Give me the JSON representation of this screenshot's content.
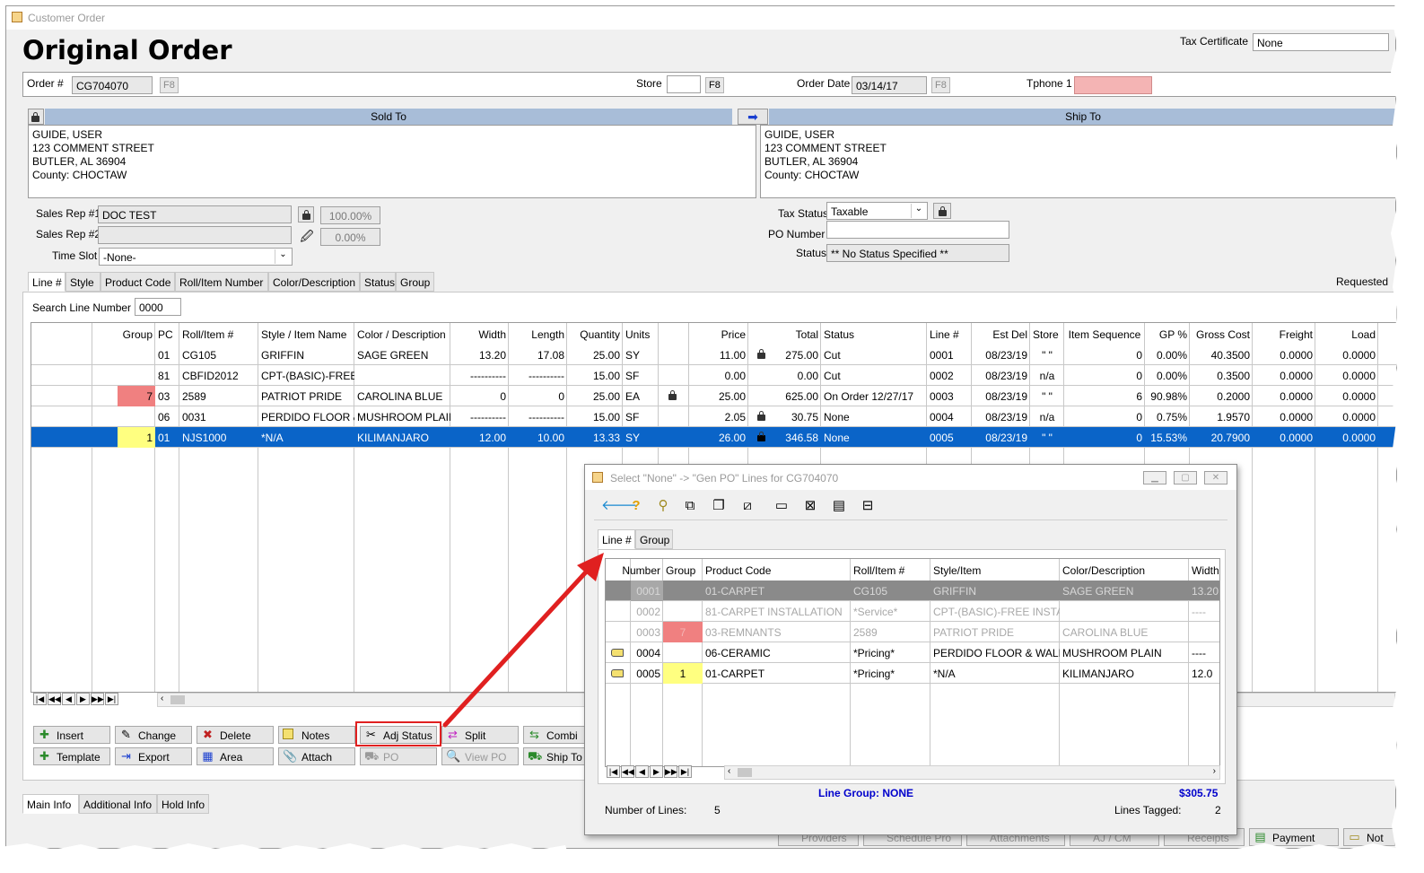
{
  "window": {
    "title": "Customer Order",
    "heading": "Original Order"
  },
  "tax_certificate": {
    "label": "Tax Certificate",
    "value": "None"
  },
  "header": {
    "order_label": "Order #",
    "order_value": "CG704070",
    "f8": "F8",
    "store_label": "Store",
    "store_value": "",
    "order_date_label": "Order Date",
    "order_date_value": "03/14/17",
    "phone_label": "Tphone 1"
  },
  "sold_to": {
    "title": "Sold To",
    "lines": [
      "GUIDE, USER",
      "123 COMMENT STREET",
      "BUTLER, AL  36904",
      "County: CHOCTAW"
    ]
  },
  "ship_to": {
    "title": "Ship To",
    "lines": [
      "GUIDE, USER",
      "123 COMMENT STREET",
      "BUTLER, AL  36904",
      "County: CHOCTAW"
    ]
  },
  "sales": {
    "rep1_label": "Sales Rep #1",
    "rep1_value": "DOC TEST",
    "rep1_pct": "100.00%",
    "rep2_label": "Sales Rep #2",
    "rep2_value": "",
    "rep2_pct": "0.00%",
    "timeslot_label": "Time Slot",
    "timeslot_value": "-None-"
  },
  "tax": {
    "status_label": "Tax Status",
    "status_value": "Taxable",
    "po_label": "PO Number",
    "po_value": "",
    "order_status_label": "Status",
    "order_status_value": "** No Status Specified **"
  },
  "sort_tabs": [
    "Line #",
    "Style",
    "Product Code",
    "Roll/Item Number",
    "Color/Description",
    "Status",
    "Group"
  ],
  "requested_label": "Requested",
  "search": {
    "label": "Search Line Number",
    "value": "0000"
  },
  "main_grid": {
    "columns": [
      "Group",
      "PC",
      "Roll/Item #",
      "Style / Item Name",
      "Color / Description",
      "Width",
      "Length",
      "Quantity",
      "Units",
      "Price",
      "Total",
      "Status",
      "Line #",
      "Est Del",
      "Store",
      "Item Sequence",
      "GP %",
      "Gross Cost",
      "Freight",
      "Load"
    ],
    "rows": [
      {
        "group": "",
        "pc": "01",
        "roll": "CG105",
        "style": "GRIFFIN",
        "color": "SAGE GREEN",
        "width": "13.20",
        "length": "17.08",
        "qty": "25.00",
        "units": "SY",
        "price": "11.00",
        "total": "275.00",
        "status": "Cut",
        "line": "0001",
        "estdel": "08/23/19",
        "store": "\" \"",
        "seq": "0",
        "gp": "0.00%",
        "gross": "40.3500",
        "freight": "0.0000",
        "load": "0.0000"
      },
      {
        "group": "",
        "pc": "81",
        "roll": "CBFID2012",
        "style": "CPT-(BASIC)-FREE IN",
        "color": "",
        "width": "----------",
        "length": "----------",
        "qty": "15.00",
        "units": "SF",
        "price": "0.00",
        "total": "0.00",
        "status": "Cut",
        "line": "0002",
        "estdel": "08/23/19",
        "store": "n/a",
        "seq": "0",
        "gp": "0.00%",
        "gross": "0.3500",
        "freight": "0.0000",
        "load": "0.0000"
      },
      {
        "group": "7",
        "pc": "03",
        "roll": "2589",
        "style": "PATRIOT PRIDE",
        "color": "CAROLINA BLUE",
        "width": "0",
        "length": "0",
        "qty": "25.00",
        "units": "EA",
        "price": "25.00",
        "total": "625.00",
        "status": "On Order 12/27/17",
        "line": "0003",
        "estdel": "08/23/19",
        "store": "\" \"",
        "seq": "6",
        "gp": "90.98%",
        "gross": "0.2000",
        "freight": "0.0000",
        "load": "0.0000"
      },
      {
        "group": "",
        "pc": "06",
        "roll": "0031",
        "style": "PERDIDO FLOOR & W",
        "color": "MUSHROOM PLAIN",
        "width": "----------",
        "length": "----------",
        "qty": "15.00",
        "units": "SF",
        "price": "2.05",
        "total": "30.75",
        "status": "None",
        "line": "0004",
        "estdel": "08/23/19",
        "store": "n/a",
        "seq": "0",
        "gp": "0.75%",
        "gross": "1.9570",
        "freight": "0.0000",
        "load": "0.0000"
      },
      {
        "group": "1",
        "pc": "01",
        "roll": "NJS1000",
        "style": "*N/A",
        "color": "KILIMANJARO",
        "width": "12.00",
        "length": "10.00",
        "qty": "13.33",
        "units": "SY",
        "price": "26.00",
        "total": "346.58",
        "status": "None",
        "line": "0005",
        "estdel": "08/23/19",
        "store": "\" \"",
        "seq": "0",
        "gp": "15.53%",
        "gross": "20.7900",
        "freight": "0.0000",
        "load": "0.0000"
      }
    ]
  },
  "buttons": {
    "insert": "Insert",
    "change": "Change",
    "delete": "Delete",
    "notes": "Notes",
    "adj_status": "Adj Status",
    "split": "Split",
    "combine": "Combi",
    "template": "Template",
    "export": "Export",
    "area": "Area",
    "attach": "Attach",
    "po": "PO",
    "view_po": "View PO",
    "ship_to": "Ship To"
  },
  "bottom_tabs": [
    "Main Info",
    "Additional Info",
    "Hold Info"
  ],
  "status_bar": [
    "Providers",
    "Schedule Pro",
    "Attachments",
    "AJ / CM",
    "Receipts",
    "Payment",
    "Not"
  ],
  "dialog": {
    "title": "Select \"None\" -> \"Gen PO\" Lines for CG704070",
    "tabs": [
      "Line #",
      "Group"
    ],
    "columns": [
      "Number",
      "Group",
      "Product Code",
      "Roll/Item #",
      "Style/Item",
      "Color/Description",
      "Width"
    ],
    "rows": [
      {
        "num": "0001",
        "group": "",
        "product": "01-CARPET",
        "roll": "CG105",
        "style": "GRIFFIN",
        "color": "SAGE GREEN",
        "width": "13.20",
        "state": "selected"
      },
      {
        "num": "0002",
        "group": "",
        "product": "81-CARPET INSTALLATION",
        "roll": "*Service*",
        "style": "CPT-(BASIC)-FREE INSTALL",
        "color": "",
        "width": "----",
        "state": "disabled"
      },
      {
        "num": "0003",
        "group": "7",
        "product": "03-REMNANTS",
        "roll": "2589",
        "style": "PATRIOT PRIDE",
        "color": "CAROLINA BLUE",
        "width": "",
        "state": "disabled"
      },
      {
        "num": "0004",
        "group": "",
        "product": "06-CERAMIC",
        "roll": "*Pricing*",
        "style": "PERDIDO FLOOR & WALL F",
        "color": "MUSHROOM PLAIN",
        "width": "----",
        "state": "tagged"
      },
      {
        "num": "0005",
        "group": "1",
        "product": "01-CARPET",
        "roll": "*Pricing*",
        "style": "*N/A",
        "color": "KILIMANJARO",
        "width": "12.0",
        "state": "tagged"
      }
    ],
    "line_group": "Line Group: NONE",
    "total": "$305.75",
    "num_lines_label": "Number of Lines:",
    "num_lines": "5",
    "tagged_label": "Lines Tagged:",
    "tagged": "2"
  },
  "colors": {
    "selection": "#0a64c8",
    "header_bar": "#a8bdd8",
    "group_red": "#f08080",
    "group_yellow": "#ffff80",
    "annotation": "#e02020",
    "link_blue": "#0000cc"
  }
}
